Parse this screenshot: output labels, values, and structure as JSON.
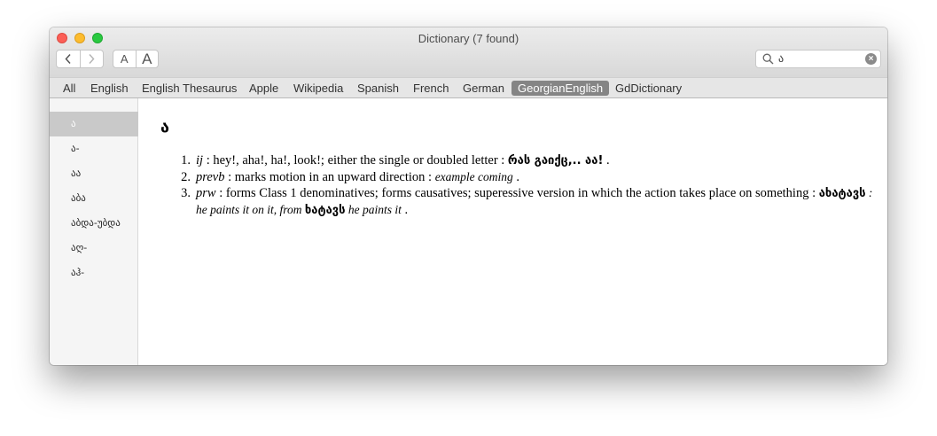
{
  "window": {
    "title": "Dictionary (7 found)"
  },
  "toolbar": {
    "back_icon": "chevron-left-icon",
    "forward_icon": "chevron-right-icon",
    "font_smaller_label": "A",
    "font_larger_label": "A"
  },
  "search": {
    "value": "ა",
    "icon": "search-icon",
    "clear_icon": "clear-icon"
  },
  "tabs": [
    {
      "label": "All"
    },
    {
      "label": "English"
    },
    {
      "label": "English Thesaurus"
    },
    {
      "label": "Apple"
    },
    {
      "label": "Wikipedia"
    },
    {
      "label": "Spanish"
    },
    {
      "label": "French"
    },
    {
      "label": "German"
    },
    {
      "label": "GeorgianEnglish",
      "active": true
    },
    {
      "label": "GdDictionary"
    }
  ],
  "sidebar": {
    "items": [
      {
        "label": "ა",
        "selected": true
      },
      {
        "label": "ა-"
      },
      {
        "label": "აა"
      },
      {
        "label": "აბა"
      },
      {
        "label": "აბდა-უბდა"
      },
      {
        "label": "აღ-"
      },
      {
        "label": "აჰ-"
      }
    ]
  },
  "entry": {
    "headword": "ა",
    "definitions": [
      {
        "num": "1.",
        "pos": "ij",
        "text": " : hey!, aha!, ha!, look!; either the single or doubled letter : ",
        "geo_example": "რას გაიქც,.. აა!",
        "tail": " ."
      },
      {
        "num": "2.",
        "pos": "prevb",
        "text": " : marks motion in an upward direction : ",
        "example": "example coming",
        "tail": " ."
      },
      {
        "num": "3.",
        "pos": "prw",
        "text": " : forms Class 1 denominatives; forms causatives; superessive version in which the action takes place on something : ",
        "geo_1": "ახატავს",
        "ex_1": " : he paints it on it, from ",
        "geo_2": "ხატავს",
        "ex_2": " he paints it",
        "tail": " ."
      }
    ]
  },
  "colors": {
    "active_tab": "#858585",
    "selected_sidebar": "#c9c9c9"
  }
}
